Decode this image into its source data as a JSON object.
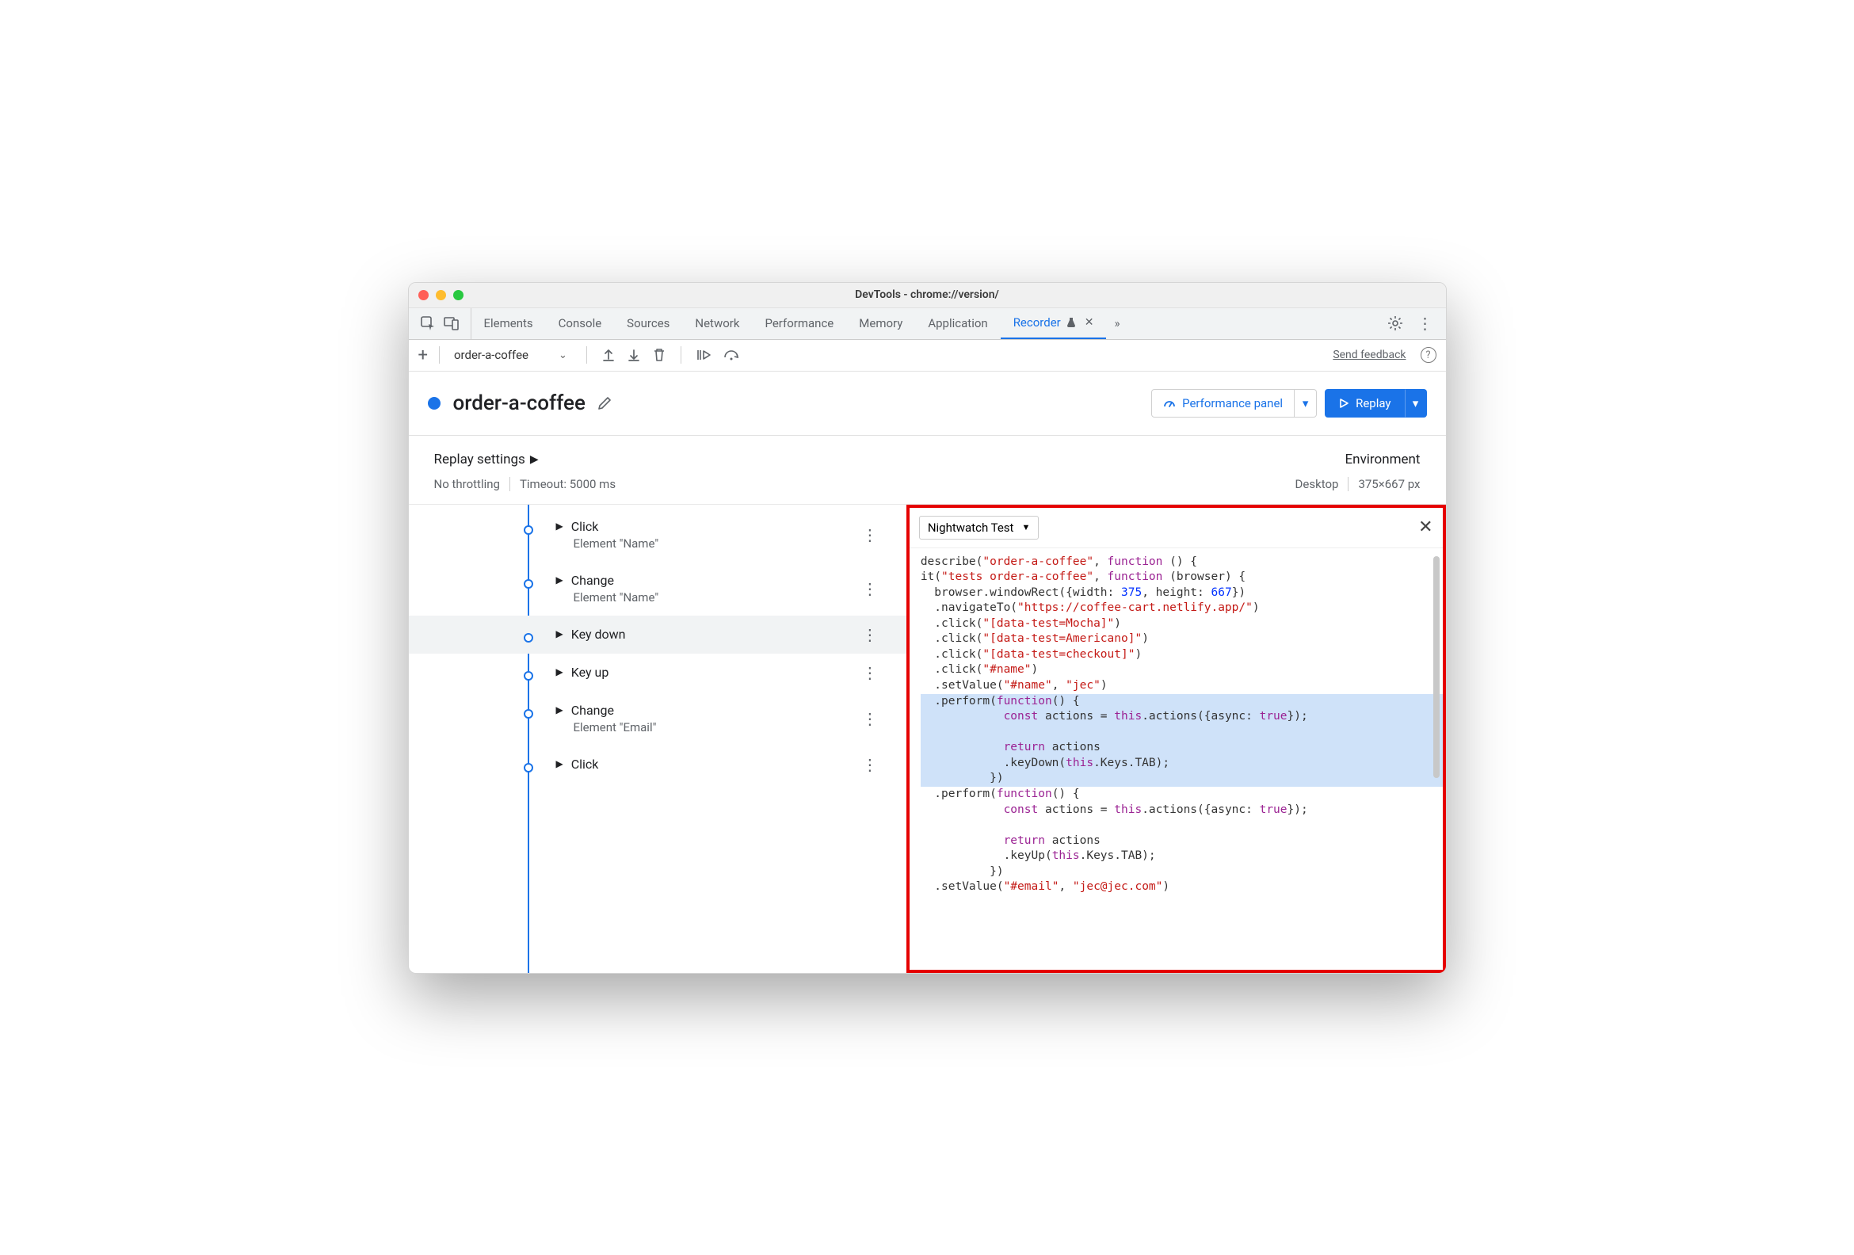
{
  "window_title": "DevTools - chrome://version/",
  "tabs": {
    "elements": "Elements",
    "console": "Console",
    "sources": "Sources",
    "network": "Network",
    "performance": "Performance",
    "memory": "Memory",
    "application": "Application",
    "recorder": "Recorder"
  },
  "toolbar": {
    "recording_name": "order-a-coffee",
    "feedback": "Send feedback"
  },
  "header": {
    "title": "order-a-coffee",
    "perf_label": "Performance panel",
    "replay_label": "Replay"
  },
  "replay_settings": {
    "label": "Replay settings",
    "throttling": "No throttling",
    "timeout": "Timeout: 5000 ms",
    "env_label": "Environment",
    "env_value": "Desktop",
    "viewport": "375×667 px"
  },
  "steps": [
    {
      "title": "Click",
      "subtitle": "Element \"Name\""
    },
    {
      "title": "Change",
      "subtitle": "Element \"Name\""
    },
    {
      "title": "Key down",
      "subtitle": ""
    },
    {
      "title": "Key up",
      "subtitle": ""
    },
    {
      "title": "Change",
      "subtitle": "Element \"Email\""
    },
    {
      "title": "Click",
      "subtitle": ""
    }
  ],
  "codepane": {
    "format_label": "Nightwatch Test",
    "code": {
      "describe_name": "\"order-a-coffee\"",
      "it_name": "\"tests order-a-coffee\"",
      "width": "375",
      "height": "667",
      "url": "\"https://coffee-cart.netlify.app/\"",
      "selectors": {
        "mocha": "\"[data-test=Mocha]\"",
        "americano": "\"[data-test=Americano]\"",
        "checkout": "\"[data-test=checkout]\"",
        "name": "\"#name\"",
        "name_val": "\"jec\"",
        "email": "\"#email\"",
        "email_val": "\"jec@jec.com\""
      },
      "kw": {
        "function": "function",
        "const": "const",
        "return": "return",
        "this": "this",
        "true": "true"
      }
    }
  }
}
